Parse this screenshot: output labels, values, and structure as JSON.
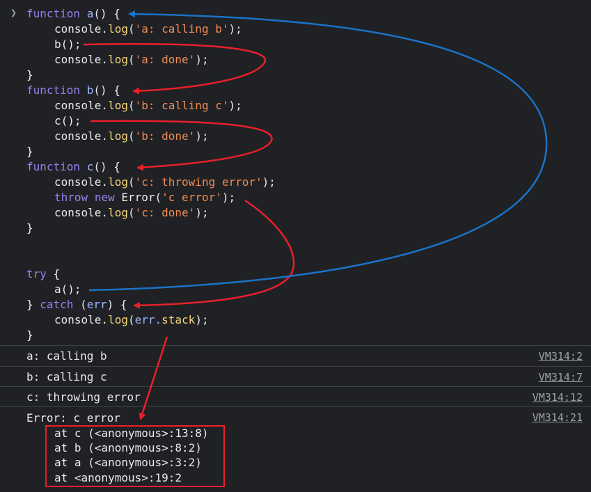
{
  "prompt_icon": "chevron-right-icon",
  "code": {
    "l1": {
      "kw": "function",
      "name": "a",
      "rest": "() {"
    },
    "l2": {
      "pre": "console.",
      "m": "log",
      "open": "(",
      "s": "'a: calling b'",
      "close": ");"
    },
    "l3": {
      "t": "b();"
    },
    "l4": {
      "pre": "console.",
      "m": "log",
      "open": "(",
      "s": "'a: done'",
      "close": ");"
    },
    "l5": {
      "t": "}"
    },
    "l6": {
      "kw": "function",
      "name": "b",
      "rest": "() {"
    },
    "l7": {
      "pre": "console.",
      "m": "log",
      "open": "(",
      "s": "'b: calling c'",
      "close": ");"
    },
    "l8": {
      "t": "c();"
    },
    "l9": {
      "pre": "console.",
      "m": "log",
      "open": "(",
      "s": "'b: done'",
      "close": ");"
    },
    "l10": {
      "t": "}"
    },
    "l11": {
      "kw": "function",
      "name": "c",
      "rest": "() {"
    },
    "l12": {
      "pre": "console.",
      "m": "log",
      "open": "(",
      "s": "'c: throwing error'",
      "close": ");"
    },
    "l13": {
      "kw1": "throw",
      "kw2": "new",
      "cls": "Error(",
      "s": "'c error'",
      "close": ");"
    },
    "l14": {
      "pre": "console.",
      "m": "log",
      "open": "(",
      "s": "'c: done'",
      "close": ");"
    },
    "l15": {
      "t": "}"
    },
    "l16": {
      "kw": "try",
      "rest": " {"
    },
    "l17": {
      "t": "a();"
    },
    "l18": {
      "brace": "} ",
      "kw": "catch",
      "mid": " (",
      "v": "err",
      "rest": ") {"
    },
    "l19": {
      "pre": "console.",
      "m": "log",
      "open": "(",
      "v": "err.",
      "m2": "stack",
      "close": ");"
    },
    "l20": {
      "t": "}"
    }
  },
  "messages": [
    {
      "text": "a: calling b",
      "source": "VM314:2"
    },
    {
      "text": "b: calling c",
      "source": "VM314:7"
    },
    {
      "text": "c: throwing error",
      "source": "VM314:12"
    },
    {
      "text": "Error: c error",
      "source": "VM314:21"
    }
  ],
  "stack": [
    "at c (<anonymous>:13:8)",
    "at b (<anonymous>:8:2)",
    "at a (<anonymous>:3:2)",
    "at <anonymous>:19:2"
  ],
  "colors": {
    "call_arrow": "#e8202b",
    "return_arrow": "#1a73c8",
    "stack_box": "#e8202b"
  }
}
